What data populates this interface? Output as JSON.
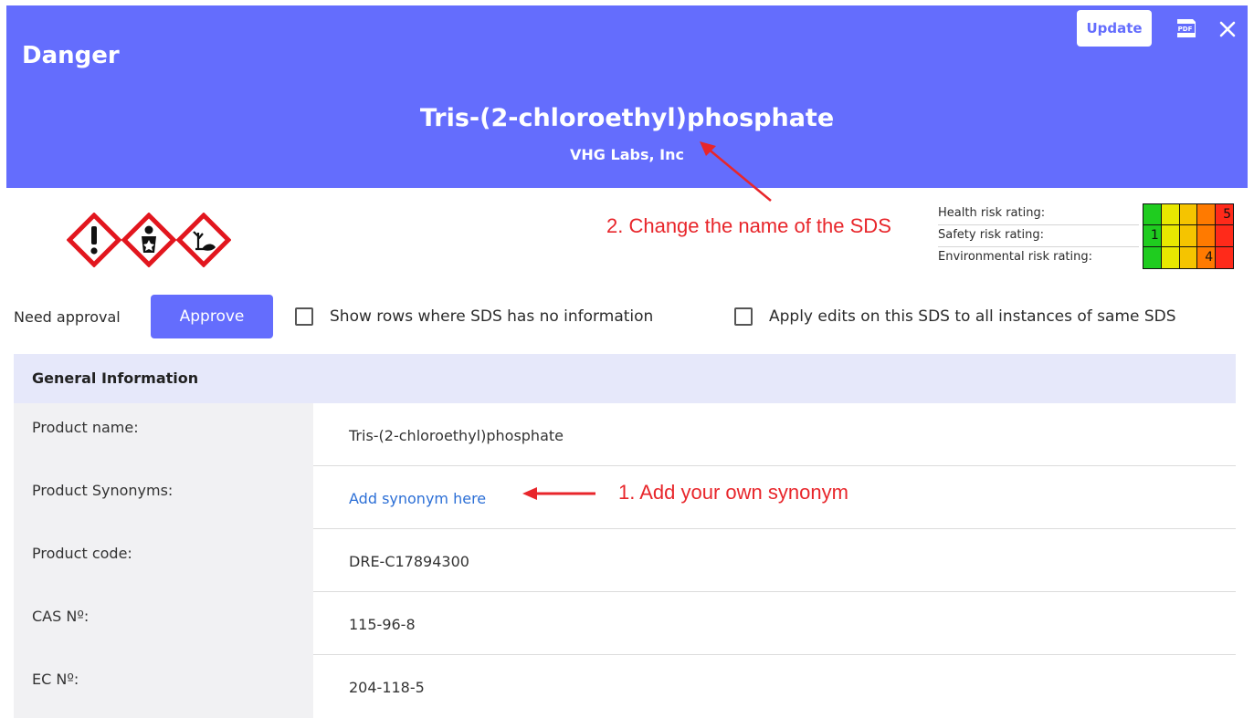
{
  "header": {
    "signal_word": "Danger",
    "product_title": "Tris-(2-chloroethyl)phosphate",
    "company": "VHG Labs, Inc",
    "update_label": "Update",
    "pdf_icon": "pdf-icon",
    "close_icon": "close-icon",
    "background_color": "#646dfd"
  },
  "pictograms": [
    "ghs-exclamation-icon",
    "ghs-health-hazard-icon",
    "ghs-environment-icon"
  ],
  "annotations": {
    "change_name": "2. Change the name of the SDS",
    "add_synonym": "1. Add your own synonym"
  },
  "risk_ratings": [
    {
      "label": "Health risk rating:",
      "value": "5",
      "level": 5
    },
    {
      "label": "Safety risk rating:",
      "value": "1",
      "level": 1
    },
    {
      "label": "Environmental risk rating:",
      "value": "4",
      "level": 4
    }
  ],
  "risk_scale_colors": [
    "#1fcc1f",
    "#e8e800",
    "#f5c400",
    "#ff7a00",
    "#ff2a1a"
  ],
  "toolbar": {
    "need_approval": "Need approval",
    "approve_label": "Approve",
    "show_rows_label": "Show rows where SDS has no information",
    "apply_edits_label": "Apply edits on this SDS to all instances of same SDS"
  },
  "general_info": {
    "title": "General Information",
    "rows": [
      {
        "label": "Product name:",
        "value": "Tris-(2-chloroethyl)phosphate"
      },
      {
        "label": "Product Synonyms:",
        "value": "Add synonym here"
      },
      {
        "label": "Product code:",
        "value": "DRE-C17894300"
      },
      {
        "label": "CAS Nº:",
        "value": "115-96-8"
      },
      {
        "label": "EC Nº:",
        "value": "204-118-5"
      }
    ]
  }
}
